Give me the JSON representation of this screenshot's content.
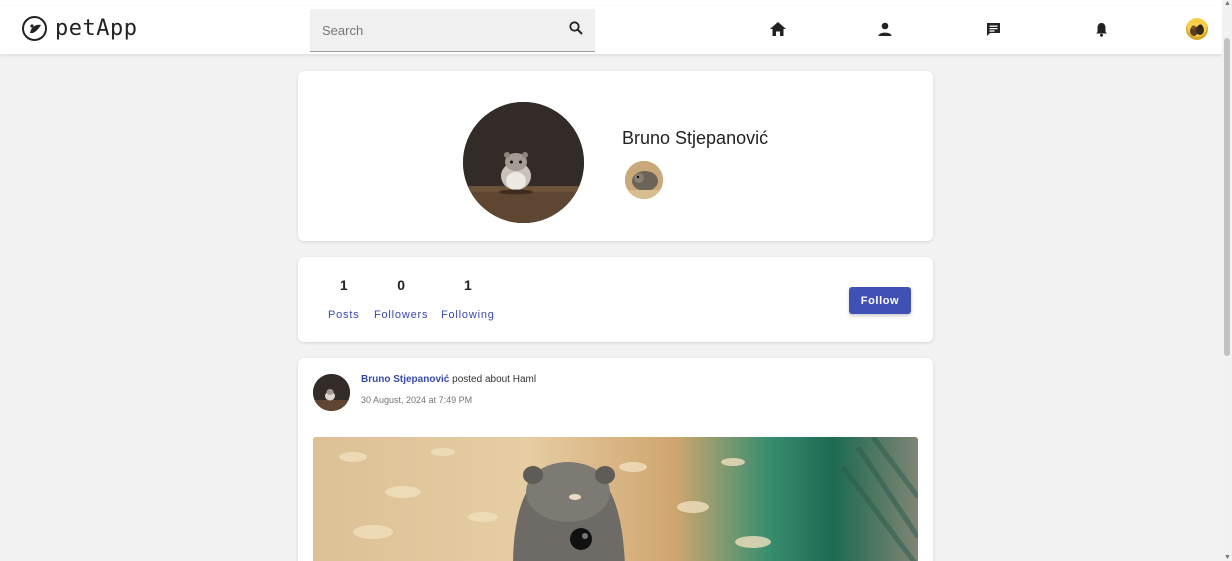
{
  "app": {
    "name": "petApp"
  },
  "search": {
    "placeholder": "Search"
  },
  "nav": {
    "icons": [
      "home-icon",
      "person-icon",
      "chat-icon",
      "bell-icon"
    ]
  },
  "profile": {
    "name": "Bruno Stjepanović"
  },
  "stats": {
    "posts": {
      "value": "1",
      "label": "Posts"
    },
    "followers": {
      "value": "0",
      "label": "Followers"
    },
    "following": {
      "value": "1",
      "label": "Following"
    },
    "follow_label": "Follow"
  },
  "post": {
    "author": "Bruno Stjepanović",
    "action_text": " posted about Haml",
    "date": "30 August, 2024 at 7:49 PM"
  },
  "colors": {
    "accent": "#3f51b5",
    "link": "#3949ab",
    "background": "#f2f2f2"
  }
}
